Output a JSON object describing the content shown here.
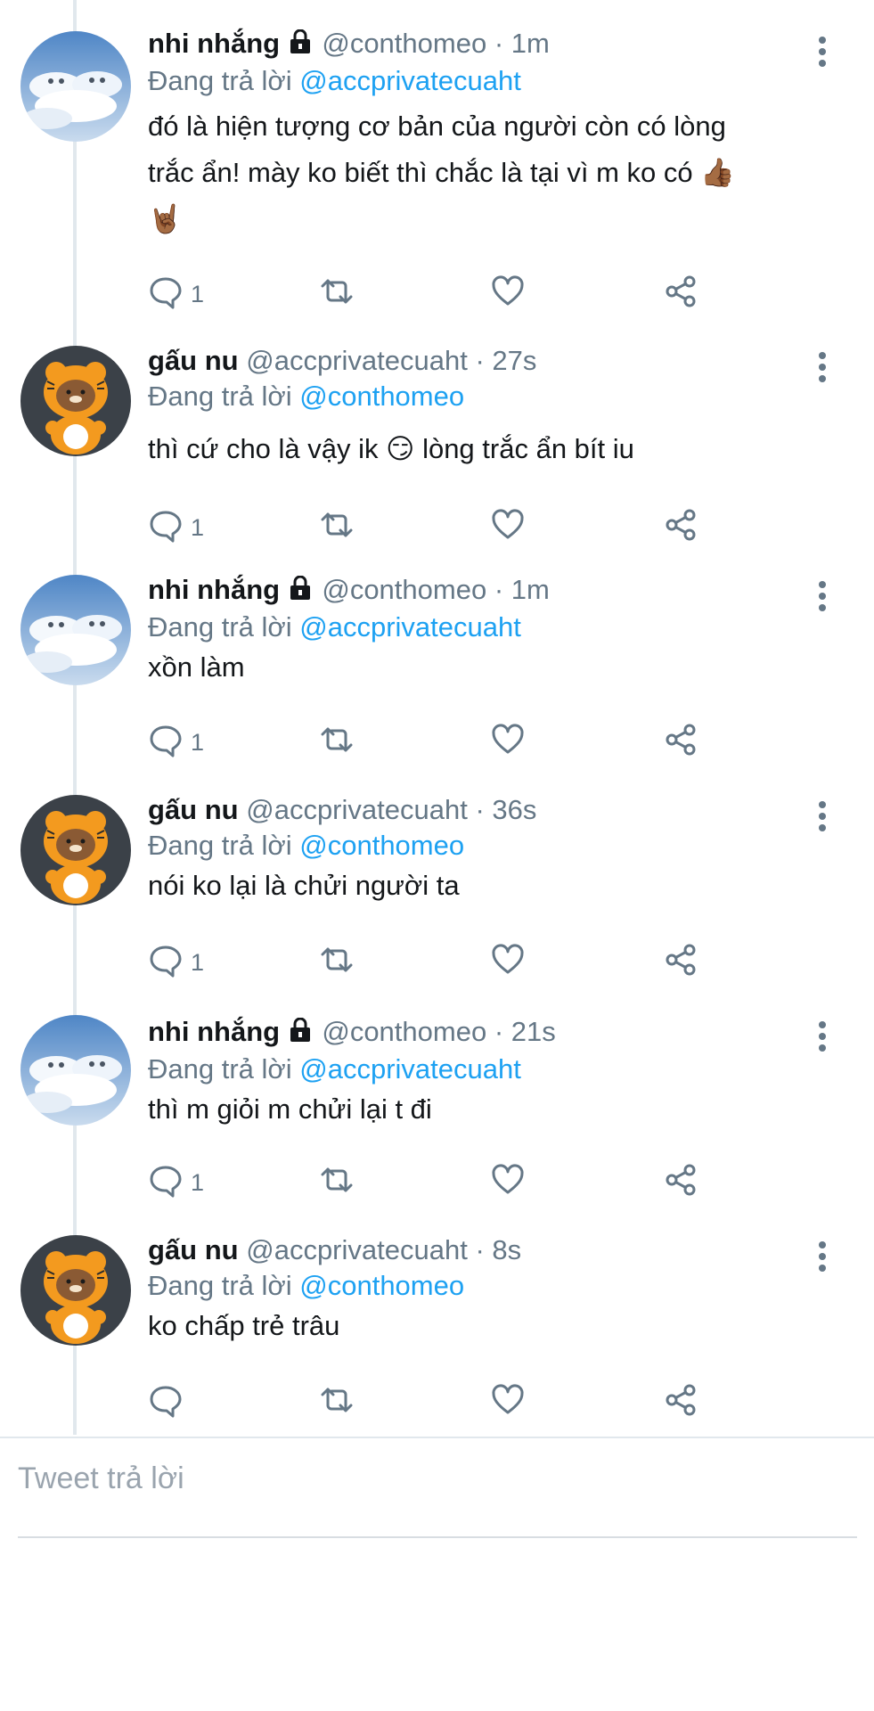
{
  "thread": {
    "tweets": [
      {
        "name": "nhi nhắng",
        "handle": "@conthomeo",
        "time": "1m",
        "locked": true,
        "avatar": "clouds-avatar",
        "replying_prefix": "Đang trả lời",
        "replying_to": "@accprivatecuaht",
        "lines": [
          "đó là hiện tượng cơ bản của người còn có lòng",
          "trắc ẩn! mày ko biết thì chắc là tại vì m ko có 👍🏾",
          "🤘🏾"
        ],
        "reply_count": "1"
      },
      {
        "name": "gấu nu",
        "handle": "@accprivatecuaht",
        "time": "27s",
        "locked": false,
        "avatar": "tiger-bear-avatar",
        "replying_prefix": "Đang trả lời",
        "replying_to": "@conthomeo",
        "lines": [
          "thì cứ cho là vậy ik 😏  lòng trắc ẩn bít iu"
        ],
        "reply_count": "1"
      },
      {
        "name": "nhi nhắng",
        "handle": "@conthomeo",
        "time": "1m",
        "locked": true,
        "avatar": "clouds-avatar",
        "replying_prefix": "Đang trả lời",
        "replying_to": "@accprivatecuaht",
        "lines": [
          "xồn làm"
        ],
        "reply_count": "1"
      },
      {
        "name": "gấu nu",
        "handle": "@accprivatecuaht",
        "time": "36s",
        "locked": false,
        "avatar": "tiger-bear-avatar",
        "replying_prefix": "Đang trả lời",
        "replying_to": "@conthomeo",
        "lines": [
          "nói ko lại là chửi người ta"
        ],
        "reply_count": "1"
      },
      {
        "name": "nhi nhắng",
        "handle": "@conthomeo",
        "time": "21s",
        "locked": true,
        "avatar": "clouds-avatar",
        "replying_prefix": "Đang trả lời",
        "replying_to": "@accprivatecuaht",
        "lines": [
          "thì m giỏi m chửi lại t đi"
        ],
        "reply_count": "1"
      },
      {
        "name": "gấu nu",
        "handle": "@accprivatecuaht",
        "time": "8s",
        "locked": false,
        "avatar": "tiger-bear-avatar",
        "replying_prefix": "Đang trả lời",
        "replying_to": "@conthomeo",
        "lines": [
          "ko chấp trẻ trâu"
        ],
        "reply_count": ""
      }
    ]
  },
  "composer": {
    "placeholder": "Tweet trả lời"
  },
  "colors": {
    "accent": "#1da1f2",
    "muted": "#657786",
    "text": "#14171a",
    "divider": "#e1e8ed"
  },
  "icons": {
    "reply": "reply-icon",
    "retweet": "retweet-icon",
    "like": "heart-icon",
    "share": "share-icon",
    "more": "more-vertical-icon",
    "lock": "lock-icon"
  }
}
